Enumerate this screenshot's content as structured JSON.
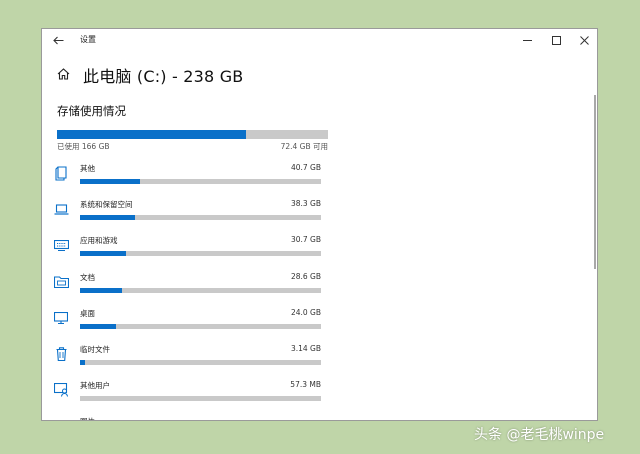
{
  "window": {
    "title": "设置"
  },
  "page": {
    "title": "此电脑 (C:) - 238 GB"
  },
  "storage": {
    "section_title": "存储使用情况",
    "used_label": "已使用 166 GB",
    "available_label": "72.4 GB 可用",
    "used_fraction": 0.697
  },
  "categories": [
    {
      "name": "其他",
      "size": "40.7 GB",
      "fraction": 0.25,
      "icon": "other-icon"
    },
    {
      "name": "系统和保留空间",
      "size": "38.3 GB",
      "fraction": 0.23,
      "icon": "laptop-icon"
    },
    {
      "name": "应用和游戏",
      "size": "30.7 GB",
      "fraction": 0.19,
      "icon": "keyboard-icon"
    },
    {
      "name": "文档",
      "size": "28.6 GB",
      "fraction": 0.175,
      "icon": "folder-icon"
    },
    {
      "name": "桌面",
      "size": "24.0 GB",
      "fraction": 0.15,
      "icon": "monitor-icon"
    },
    {
      "name": "临时文件",
      "size": "3.14 GB",
      "fraction": 0.02,
      "icon": "trash-icon"
    },
    {
      "name": "其他用户",
      "size": "57.3 MB",
      "fraction": 0.0,
      "icon": "user-icon"
    },
    {
      "name": "图片",
      "size": "",
      "fraction": 0.0,
      "icon": "picture-icon"
    }
  ],
  "colors": {
    "accent": "#0a70c9",
    "track": "#c9c9c9",
    "background": "#bfd5a8"
  },
  "watermark": "头条 @老毛桃winpe"
}
